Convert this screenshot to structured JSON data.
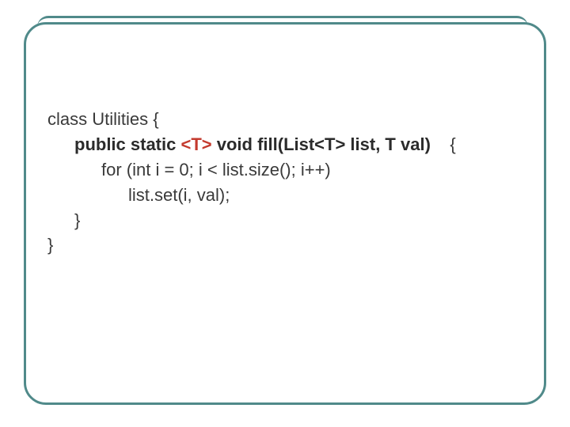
{
  "code": {
    "line1": "class Utilities {",
    "line2_prefix": "public static ",
    "line2_generic": "<T>",
    "line2_suffix": " void fill(List<T> list, T val)",
    "line2_brace": "{",
    "line3": "for (int i = 0; i < list.size(); i++)",
    "line4": "list.set(i, val);",
    "line5": "}",
    "line6": "}"
  }
}
